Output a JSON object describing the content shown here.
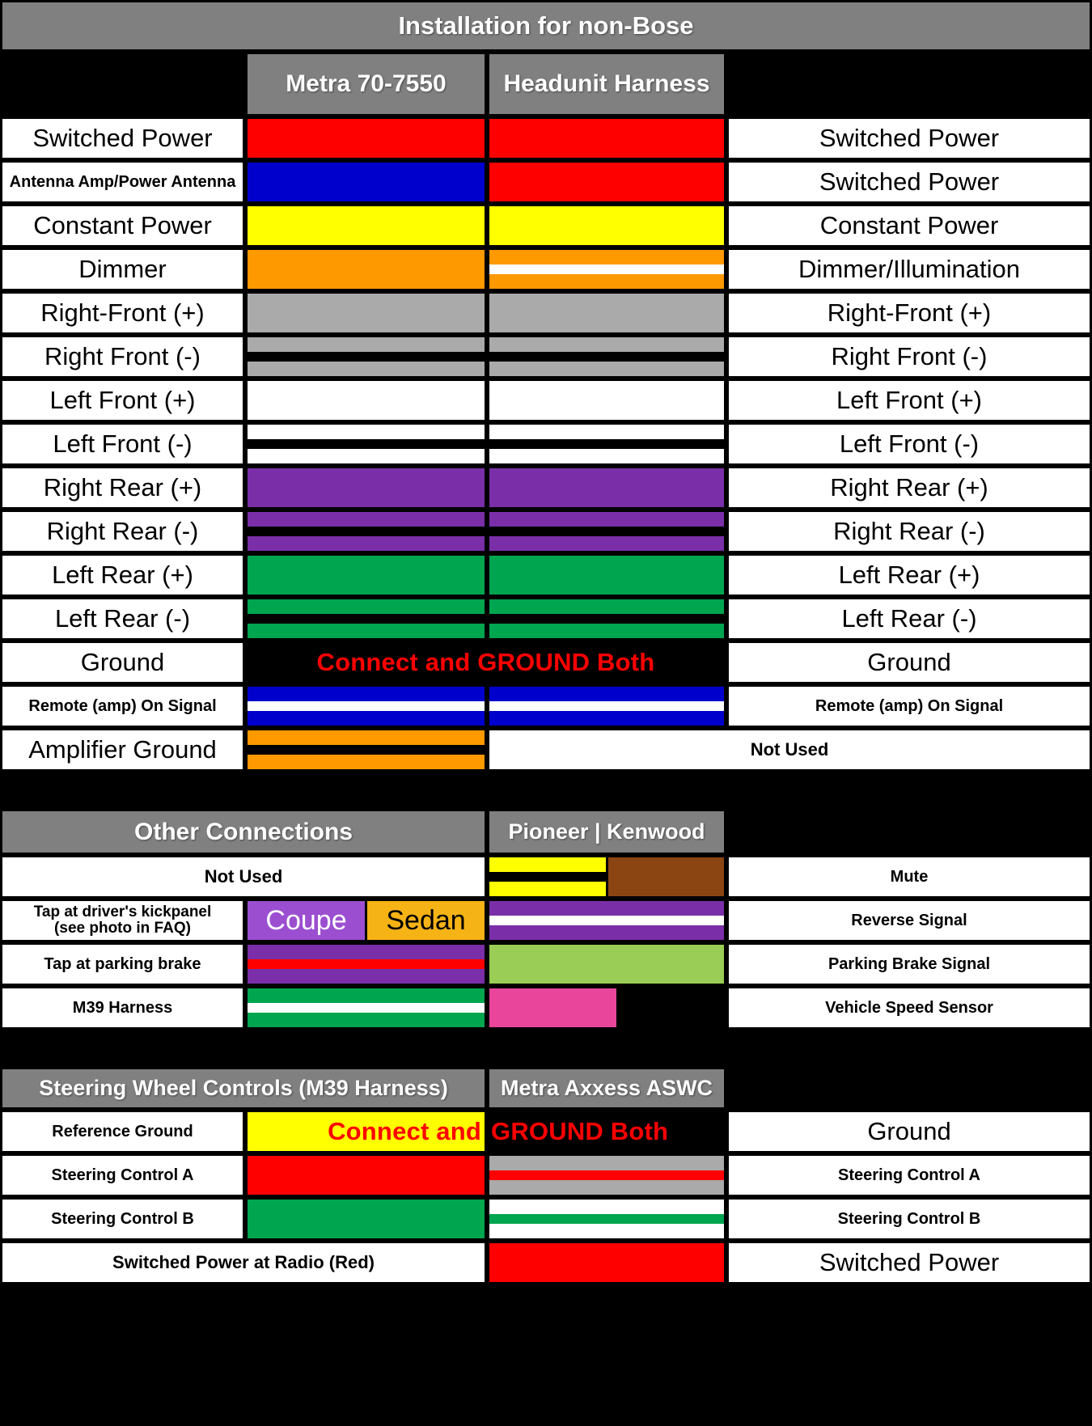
{
  "colors": {
    "red": "#FF0000",
    "blue": "#0000CC",
    "yellow": "#FFFF00",
    "orange": "#FF9900",
    "grey": "#AAAAAA",
    "white": "#FFFFFF",
    "black": "#000000",
    "purple": "#7A2FA8",
    "green": "#00A550",
    "brown": "#8B4513",
    "lightgreen": "#9ACD55",
    "pink": "#E8459B",
    "coupe_purple": "#9B4FD0",
    "sedan_amber": "#F5B316",
    "header_grey": "#808080",
    "note_red": "#FF0000"
  },
  "section1": {
    "title": "Installation for non-Bose",
    "col_headers": {
      "metra": "Metra 70-7550",
      "headunit": "Headunit Harness"
    },
    "rows": [
      {
        "left": "Switched Power",
        "right": "Switched Power",
        "metra_wire": [
          "red"
        ],
        "head_wire": [
          "red"
        ]
      },
      {
        "left": "Antenna Amp/Power Antenna",
        "right": "Switched Power",
        "metra_wire": [
          "blue"
        ],
        "head_wire": [
          "red"
        ]
      },
      {
        "left": "Constant Power",
        "right": "Constant Power",
        "metra_wire": [
          "yellow"
        ],
        "head_wire": [
          "yellow"
        ]
      },
      {
        "left": "Dimmer",
        "right": "Dimmer/Illumination",
        "metra_wire": [
          "orange"
        ],
        "head_wire": [
          "orange",
          "white",
          "orange"
        ]
      },
      {
        "left": "Right-Front (+)",
        "right": "Right-Front (+)",
        "metra_wire": [
          "grey"
        ],
        "head_wire": [
          "grey"
        ]
      },
      {
        "left": "Right Front (-)",
        "right": "Right Front (-)",
        "metra_wire": [
          "grey",
          "black",
          "grey"
        ],
        "head_wire": [
          "grey",
          "black",
          "grey"
        ]
      },
      {
        "left": "Left Front (+)",
        "right": "Left Front (+)",
        "metra_wire": [
          "white"
        ],
        "head_wire": [
          "white"
        ]
      },
      {
        "left": "Left Front (-)",
        "right": "Left Front (-)",
        "metra_wire": [
          "white",
          "black",
          "white"
        ],
        "head_wire": [
          "white",
          "black",
          "white"
        ]
      },
      {
        "left": "Right Rear (+)",
        "right": "Right Rear (+)",
        "metra_wire": [
          "purple"
        ],
        "head_wire": [
          "purple"
        ]
      },
      {
        "left": "Right Rear (-)",
        "right": "Right Rear (-)",
        "metra_wire": [
          "purple",
          "black",
          "purple"
        ],
        "head_wire": [
          "purple",
          "black",
          "purple"
        ]
      },
      {
        "left": "Left Rear (+)",
        "right": "Left Rear (+)",
        "metra_wire": [
          "green"
        ],
        "head_wire": [
          "green"
        ]
      },
      {
        "left": "Left Rear (-)",
        "right": "Left Rear (-)",
        "metra_wire": [
          "green",
          "black",
          "green"
        ],
        "head_wire": [
          "green",
          "black",
          "green"
        ]
      },
      {
        "left": "Ground",
        "right": "Ground",
        "note": "Connect and GROUND Both",
        "metra_wire": [
          "black"
        ],
        "head_wire": [
          "black"
        ]
      },
      {
        "left": "Remote (amp) On Signal",
        "right": "Remote (amp) On Signal",
        "metra_wire": [
          "blue",
          "white",
          "blue"
        ],
        "head_wire": [
          "blue",
          "white",
          "blue"
        ]
      },
      {
        "left": "Amplifier Ground",
        "right": "Not Used",
        "metra_wire": [
          "orange",
          "black",
          "orange"
        ],
        "head_wire": [
          "white"
        ]
      }
    ]
  },
  "section2": {
    "title": "Other Connections",
    "col_header": "Pioneer | Kenwood",
    "rows": [
      {
        "left": "Not Used",
        "right": "Mute",
        "left_span": true,
        "head_split": {
          "left_wire": [
            "yellow",
            "black",
            "yellow"
          ],
          "right_wire": [
            "brown"
          ]
        }
      },
      {
        "left": "Tap at driver's kickpanel (see photo in FAQ)",
        "right": "Reverse Signal",
        "variant_a": "Coupe",
        "variant_b": "Sedan",
        "head_wire": [
          "purple",
          "white",
          "purple"
        ]
      },
      {
        "left": "Tap at parking brake",
        "right": "Parking Brake Signal",
        "metra_wire": [
          "purple",
          "red",
          "purple"
        ],
        "head_wire": [
          "lightgreen"
        ]
      },
      {
        "left": "M39 Harness",
        "right": "Vehicle Speed Sensor",
        "metra_wire": [
          "green",
          "white",
          "green"
        ],
        "head_half_wire": [
          "pink"
        ]
      }
    ]
  },
  "section3": {
    "title": "Steering Wheel Controls (M39 Harness)",
    "col_header": "Metra Axxess ASWC",
    "rows": [
      {
        "left": "Reference Ground",
        "right": "Ground",
        "note": "Connect and GROUND Both",
        "metra_wire": [
          "yellow"
        ],
        "head_wire": [
          "black"
        ]
      },
      {
        "left": "Steering Control A",
        "right": "Steering Control A",
        "metra_wire": [
          "red"
        ],
        "head_wire": [
          "grey",
          "red",
          "grey"
        ]
      },
      {
        "left": "Steering Control B",
        "right": "Steering Control B",
        "metra_wire": [
          "green"
        ],
        "head_wire": [
          "white",
          "green",
          "white"
        ]
      },
      {
        "left": "Switched Power at Radio (Red)",
        "right": "Switched Power",
        "left_span": true,
        "head_wire": [
          "red"
        ]
      }
    ]
  }
}
